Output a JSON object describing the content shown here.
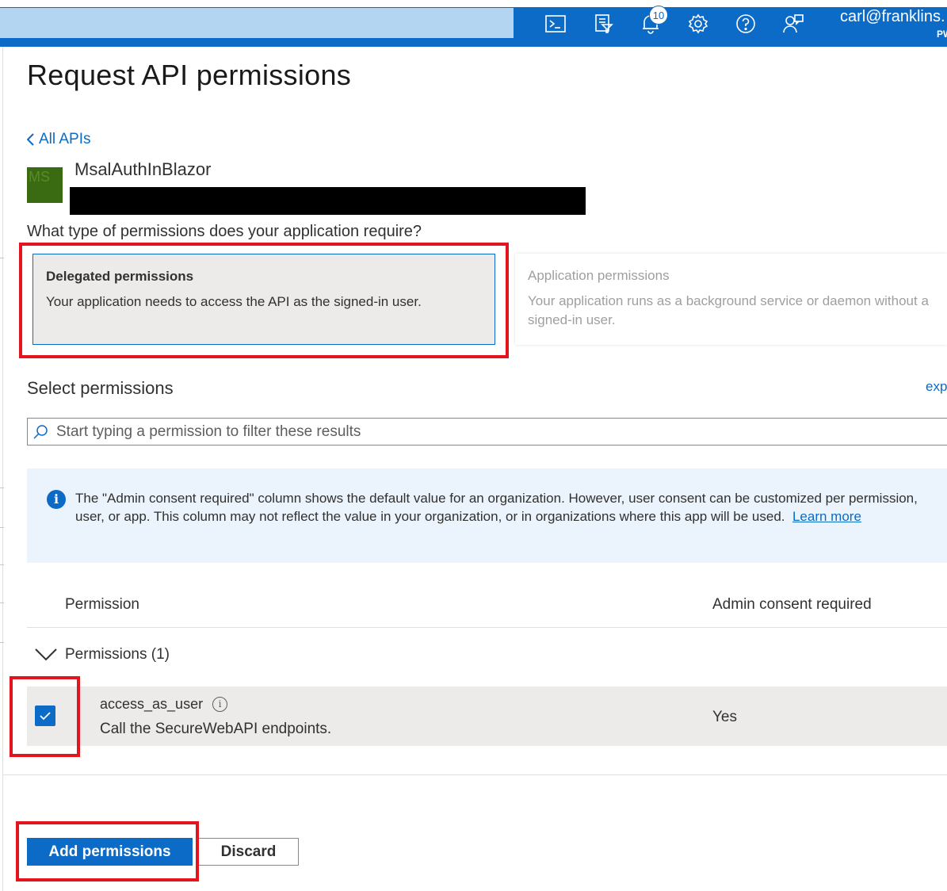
{
  "topbar": {
    "search_placeholder": "",
    "notification_count": "10",
    "user_email": "carl@franklins.",
    "user_directory": "PW",
    "icons": [
      "cloud-shell-icon",
      "directory-filter-icon",
      "notifications-icon",
      "settings-icon",
      "help-icon",
      "feedback-icon"
    ]
  },
  "page": {
    "title": "Request API permissions",
    "back_link": "All APIs",
    "app_logo_text": "MS",
    "app_name": "MsalAuthInBlazor",
    "question": "What type of permissions does your application require?"
  },
  "permission_types": [
    {
      "title": "Delegated permissions",
      "description": "Your application needs to access the API as the signed-in user.",
      "selected": true
    },
    {
      "title": "Application permissions",
      "description": "Your application runs as a background service or daemon without a signed-in user.",
      "selected": false
    }
  ],
  "select": {
    "title": "Select permissions",
    "expand_link": "exp",
    "filter_placeholder": "Start typing a permission to filter these results"
  },
  "info": {
    "text": "The \"Admin consent required\" column shows the default value for an organization. However, user consent can be customized per permission, user, or app. This column may not reflect the value in your organization, or in organizations where this app will be used.",
    "link": "Learn more"
  },
  "table": {
    "columns": [
      "Permission",
      "Admin consent required"
    ],
    "group_label": "Permissions (1)",
    "rows": [
      {
        "name": "access_as_user",
        "description": "Call the SecureWebAPI endpoints.",
        "admin_consent": "Yes",
        "checked": true
      }
    ]
  },
  "actions": {
    "primary": "Add permissions",
    "secondary": "Discard"
  },
  "colors": {
    "accent": "#0b6bc7",
    "highlight": "#e3141d"
  }
}
